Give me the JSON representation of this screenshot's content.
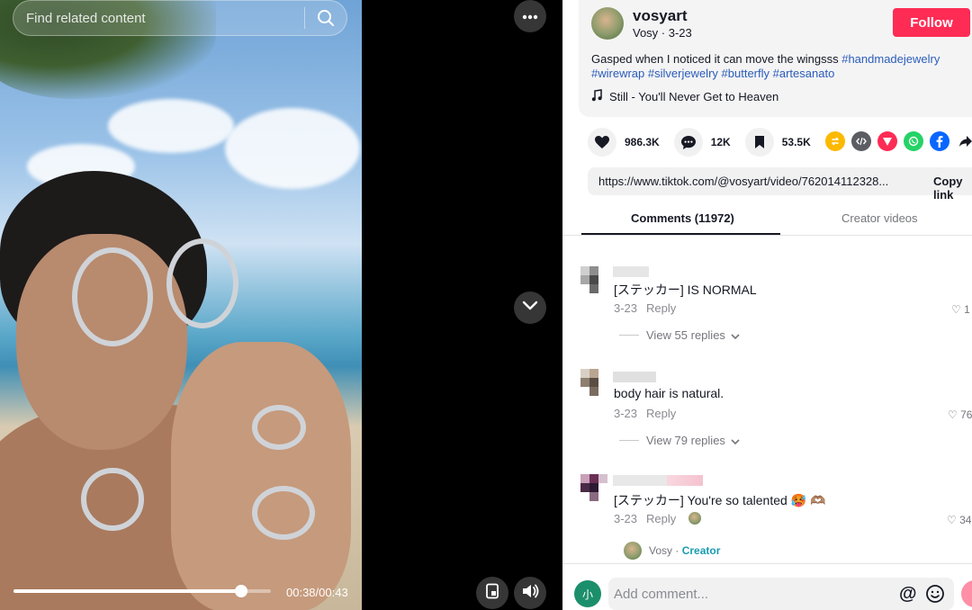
{
  "search": {
    "placeholder": "Find related content"
  },
  "player": {
    "current_time": "00:38",
    "duration": "00:43",
    "time_display": "00:38/00:43",
    "progress_fraction": 0.884
  },
  "author": {
    "username": "vosyart",
    "subline": "Vosy · 3-23",
    "follow_label": "Follow"
  },
  "caption": {
    "text": "Gasped when I noticed it can move the wingsss",
    "hashtags": [
      "#handmadejewelry",
      "#wirewrap",
      "#silverjewelry",
      "#butterfly",
      "#artesanato"
    ]
  },
  "music": {
    "label": "Still - You'll Never Get to Heaven"
  },
  "stats": {
    "likes": "986.3K",
    "comments": "12K",
    "saves": "53.5K"
  },
  "link": {
    "url": "https://www.tiktok.com/@vosyart/video/762014112328...",
    "copy_label": "Copy link"
  },
  "tabs": [
    {
      "label": "Comments (11972)"
    },
    {
      "label": "Creator videos"
    }
  ],
  "comments": [
    {
      "text": "[ステッカー] IS NORMAL",
      "date": "3-23",
      "reply_label": "Reply",
      "likes": "1",
      "view_replies": "View 55 replies"
    },
    {
      "text": "body hair is natural.",
      "date": "3-23",
      "reply_label": "Reply",
      "likes": "76",
      "view_replies": "View 79 replies"
    },
    {
      "text": "[ステッカー] You're so talented 🥵 🫶🏽",
      "date": "3-23",
      "reply_label": "Reply",
      "likes": "34"
    }
  ],
  "creator_reply": {
    "name": "Vosy",
    "badge": "Creator"
  },
  "composer": {
    "avatar_initial": "小",
    "placeholder": "Add comment...",
    "at_symbol": "@"
  },
  "colors": {
    "follow_red": "#fe2c55",
    "hashtag_blue": "#2b5db9",
    "tab_active": "#161823",
    "creator_teal": "#1a9bb0"
  }
}
